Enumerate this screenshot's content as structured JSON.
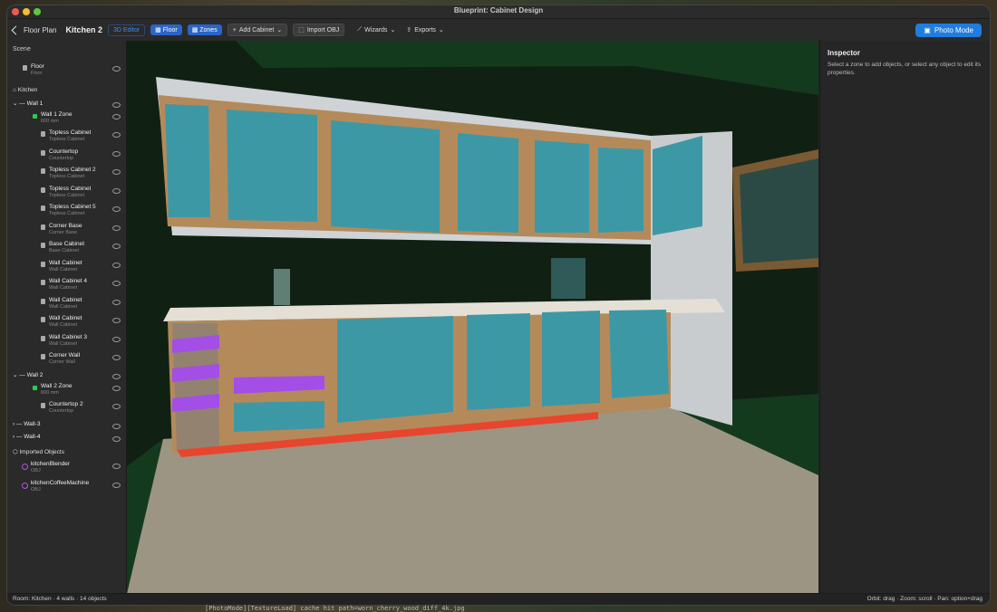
{
  "window": {
    "title": "Blueprint: Cabinet Design"
  },
  "toolbar": {
    "back_label": "Floor Plan",
    "page_title": "Kitchen 2",
    "mode_badge": "3D Editor",
    "floor_label": "Floor",
    "zones_label": "Zones",
    "add_cabinet": "Add Cabinet",
    "import_obj": "Import OBJ",
    "wizards": "Wizards",
    "exports": "Exports",
    "photo_mode": "Photo Mode"
  },
  "sidebar": {
    "heading": "Scene",
    "floor": {
      "name": "Floor",
      "type": "Floor"
    },
    "kitchen_label": "Kitchen",
    "wall1": {
      "label": "Wall 1",
      "zone": {
        "name": "Wall 1 Zone",
        "size": "600 mm"
      },
      "items": [
        {
          "name": "Topless Cabinet",
          "type": "Topless Cabinet"
        },
        {
          "name": "Countertop",
          "type": "Countertop"
        },
        {
          "name": "Topless Cabinet 2",
          "type": "Topless Cabinet"
        },
        {
          "name": "Topless Cabinet",
          "type": "Topless Cabinet"
        },
        {
          "name": "Topless Cabinet 5",
          "type": "Topless Cabinet"
        },
        {
          "name": "Corner Base",
          "type": "Corner Base"
        },
        {
          "name": "Base Cabinet",
          "type": "Base Cabinet"
        },
        {
          "name": "Wall Cabinet",
          "type": "Wall Cabinet"
        },
        {
          "name": "Wall Cabinet 4",
          "type": "Wall Cabinet"
        },
        {
          "name": "Wall Cabinet",
          "type": "Wall Cabinet"
        },
        {
          "name": "Wall Cabinet",
          "type": "Wall Cabinet"
        },
        {
          "name": "Wall Cabinet 3",
          "type": "Wall Cabinet"
        },
        {
          "name": "Corner Wall",
          "type": "Corner Wall"
        }
      ]
    },
    "wall2": {
      "label": "Wall 2",
      "zone": {
        "name": "Wall 2 Zone",
        "size": "600 mm"
      },
      "items": [
        {
          "name": "Countertop 2",
          "type": "Countertop"
        }
      ]
    },
    "wall3": {
      "label": "Wall-3"
    },
    "wall4": {
      "label": "Wall-4"
    },
    "imported_label": "Imported Objects",
    "imported": [
      {
        "name": "kitchenBlender",
        "type": "OBJ"
      },
      {
        "name": "kitchenCoffeeMachine",
        "type": "OBJ"
      }
    ]
  },
  "inspector": {
    "title": "Inspector",
    "hint": "Select a zone to add objects, or select any object to edit its properties."
  },
  "status": {
    "left": "Room: Kitchen  ·  4 walls  ·  14 objects",
    "right": "Orbit: drag  ·  Zoom: scroll  ·  Pan: option+drag"
  },
  "console": {
    "log": "[PhotoMode][TextureLoad] cache hit path=worn_cherry_wood_diff_4k.jpg"
  },
  "colors": {
    "accent": "#1f7de0",
    "cabinet_door": "#3d98a6",
    "wood_frame": "#b48a5a",
    "shelf_purple": "#a34ee6",
    "toe_kick": "#e8452f"
  }
}
